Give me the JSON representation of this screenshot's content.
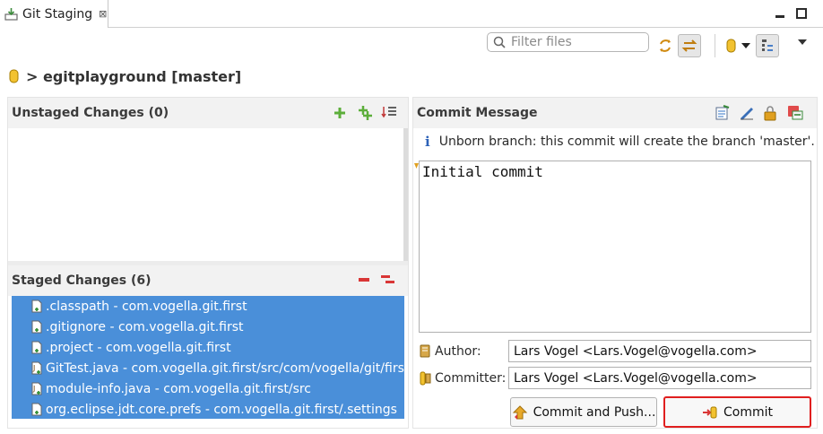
{
  "tab": {
    "title": "Git Staging",
    "close_glyph": "⊠"
  },
  "toolbar": {
    "filter_placeholder": "Filter files",
    "icons": [
      "refresh-icon",
      "link-selection-icon",
      "repository-icon",
      "dropdown-arrow-icon",
      "presentation-icon",
      "view-menu-icon"
    ]
  },
  "repo": {
    "label": "> egitplayground [master]"
  },
  "unstaged": {
    "title": "Unstaged Changes (0)",
    "items": []
  },
  "staged": {
    "title": "Staged Changes (6)",
    "items": [
      {
        "label": ".classpath - com.vogella.git.first"
      },
      {
        "label": ".gitignore - com.vogella.git.first"
      },
      {
        "label": ".project - com.vogella.git.first"
      },
      {
        "label": "GitTest.java - com.vogella.git.first/src/com/vogella/git/first"
      },
      {
        "label": "module-info.java - com.vogella.git.first/src"
      },
      {
        "label": "org.eclipse.jdt.core.prefs - com.vogella.git.first/.settings"
      }
    ]
  },
  "commit": {
    "title": "Commit Message",
    "info": "Unborn branch: this commit will create the branch 'master'.",
    "message": "Initial commit",
    "author_label": "Author:",
    "author_value": "Lars Vogel <Lars.Vogel@vogella.com>",
    "committer_label": "Committer:",
    "committer_value": "Lars Vogel <Lars.Vogel@vogella.com>",
    "commit_push_label": "Commit and Push...",
    "commit_label": "Commit"
  },
  "colors": {
    "selection": "#4a8fd9",
    "commit_border": "#e01f1f",
    "add": "#5cae3a",
    "remove": "#d93636"
  }
}
